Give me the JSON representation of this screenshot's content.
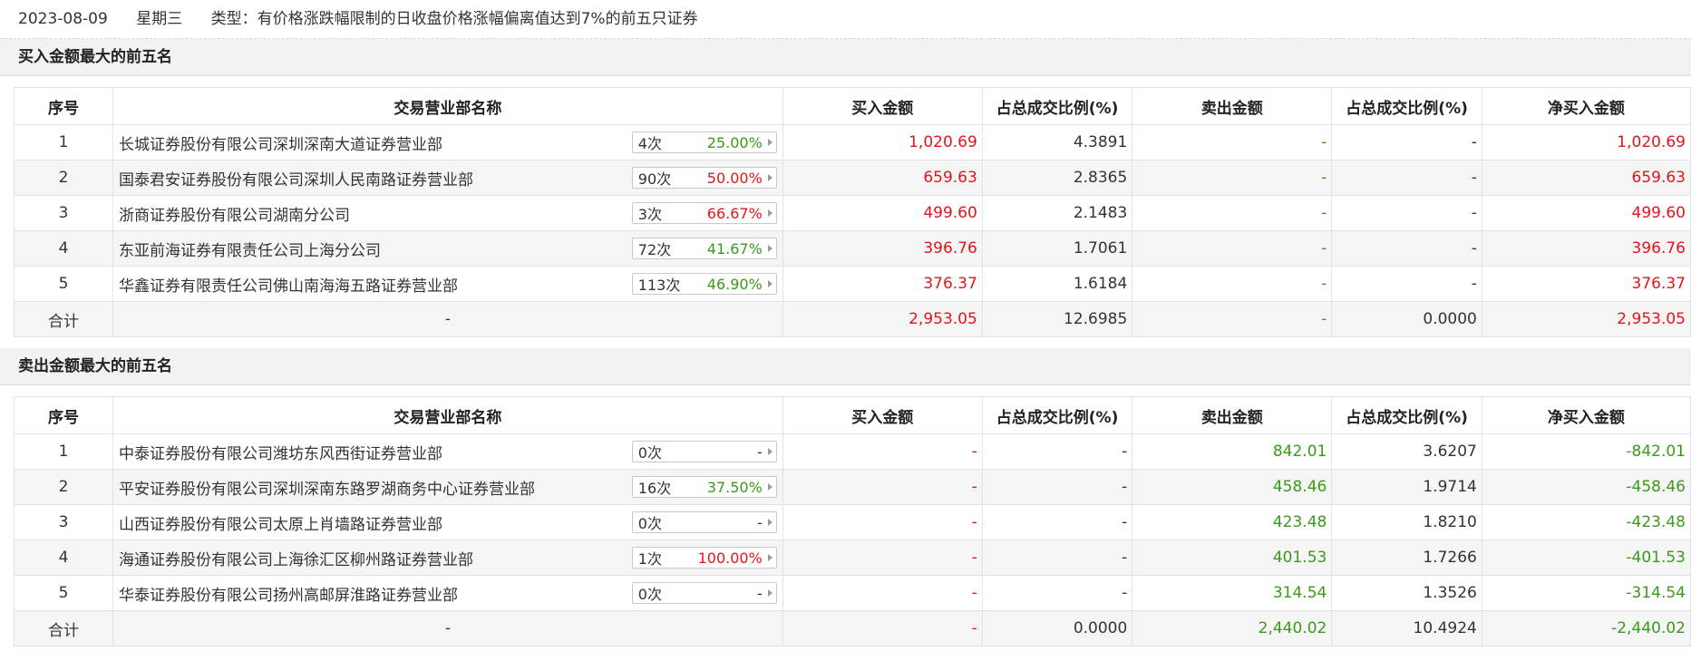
{
  "header": {
    "date": "2023-08-09",
    "weekday": "星期三",
    "type_label": "类型：有价格涨跌幅限制的日收盘价格涨幅偏离值达到7%的前五只证券"
  },
  "colors": {
    "red": "#e4141b",
    "green": "#3a9a1a"
  },
  "columns": [
    "序号",
    "交易营业部名称",
    "买入金额",
    "占总成交比例(%)",
    "卖出金额",
    "占总成交比例(%)",
    "净买入金额"
  ],
  "buy_section": {
    "title": "买入金额最大的前五名",
    "rows": [
      {
        "idx": "1",
        "name": "长城证券股份有限公司深圳深南大道证券营业部",
        "count": "4次",
        "pct": "25.00%",
        "pct_color": "green",
        "buy": "1,020.69",
        "buy_ratio": "4.3891",
        "sell": "-",
        "sell_ratio": "-",
        "net": "1,020.69"
      },
      {
        "idx": "2",
        "name": "国泰君安证券股份有限公司深圳人民南路证券营业部",
        "count": "90次",
        "pct": "50.00%",
        "pct_color": "red",
        "buy": "659.63",
        "buy_ratio": "2.8365",
        "sell": "-",
        "sell_ratio": "-",
        "net": "659.63"
      },
      {
        "idx": "3",
        "name": "浙商证券股份有限公司湖南分公司",
        "count": "3次",
        "pct": "66.67%",
        "pct_color": "red",
        "buy": "499.60",
        "buy_ratio": "2.1483",
        "sell": "-",
        "sell_ratio": "-",
        "net": "499.60"
      },
      {
        "idx": "4",
        "name": "东亚前海证券有限责任公司上海分公司",
        "count": "72次",
        "pct": "41.67%",
        "pct_color": "green",
        "buy": "396.76",
        "buy_ratio": "1.7061",
        "sell": "-",
        "sell_ratio": "-",
        "net": "396.76"
      },
      {
        "idx": "5",
        "name": "华鑫证券有限责任公司佛山南海海五路证券营业部",
        "count": "113次",
        "pct": "46.90%",
        "pct_color": "green",
        "buy": "376.37",
        "buy_ratio": "1.6184",
        "sell": "-",
        "sell_ratio": "-",
        "net": "376.37"
      }
    ],
    "total": {
      "label": "合计",
      "name": "-",
      "buy": "2,953.05",
      "buy_ratio": "12.6985",
      "sell": "-",
      "sell_ratio": "0.0000",
      "net": "2,953.05"
    }
  },
  "sell_section": {
    "title": "卖出金额最大的前五名",
    "rows": [
      {
        "idx": "1",
        "name": "中泰证券股份有限公司潍坊东风西街证券营业部",
        "count": "0次",
        "pct": "-",
        "pct_color": "dark",
        "buy": "-",
        "buy_ratio": "-",
        "sell": "842.01",
        "sell_ratio": "3.6207",
        "net": "-842.01"
      },
      {
        "idx": "2",
        "name": "平安证券股份有限公司深圳深南东路罗湖商务中心证券营业部",
        "count": "16次",
        "pct": "37.50%",
        "pct_color": "green",
        "buy": "-",
        "buy_ratio": "-",
        "sell": "458.46",
        "sell_ratio": "1.9714",
        "net": "-458.46"
      },
      {
        "idx": "3",
        "name": "山西证券股份有限公司太原上肖墙路证券营业部",
        "count": "0次",
        "pct": "-",
        "pct_color": "dark",
        "buy": "-",
        "buy_ratio": "-",
        "sell": "423.48",
        "sell_ratio": "1.8210",
        "net": "-423.48"
      },
      {
        "idx": "4",
        "name": "海通证券股份有限公司上海徐汇区柳州路证券营业部",
        "count": "1次",
        "pct": "100.00%",
        "pct_color": "red",
        "buy": "-",
        "buy_ratio": "-",
        "sell": "401.53",
        "sell_ratio": "1.7266",
        "net": "-401.53"
      },
      {
        "idx": "5",
        "name": "华泰证券股份有限公司扬州高邮屏淮路证券营业部",
        "count": "0次",
        "pct": "-",
        "pct_color": "dark",
        "buy": "-",
        "buy_ratio": "-",
        "sell": "314.54",
        "sell_ratio": "1.3526",
        "net": "-314.54"
      }
    ],
    "total": {
      "label": "合计",
      "name": "-",
      "buy": "-",
      "buy_ratio": "0.0000",
      "sell": "2,440.02",
      "sell_ratio": "10.4924",
      "net": "-2,440.02"
    }
  }
}
